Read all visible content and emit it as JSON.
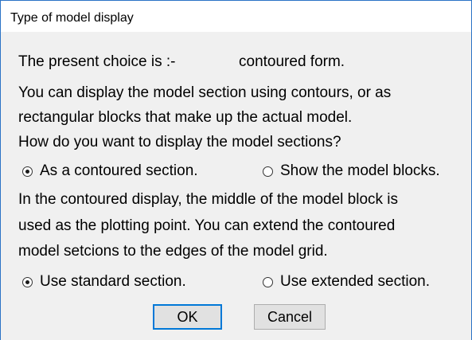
{
  "window": {
    "title": "Type of model display"
  },
  "dialog": {
    "choice_label": "The present choice is :-",
    "choice_value": "contoured form.",
    "desc_line1": "You can display the model section using contours, or as",
    "desc_line2": "rectangular blocks that make up the actual model.",
    "question": "How do you want to display the model sections?",
    "display_options": [
      {
        "label": "As a contoured section.",
        "checked": true
      },
      {
        "label": "Show the model blocks.",
        "checked": false
      }
    ],
    "contour_line1": "In the contoured display, the middle of the model block is",
    "contour_line2": "used as the plotting point. You can extend the contoured",
    "contour_line3": "model setcions to the edges of the model grid.",
    "section_options": [
      {
        "label": "Use standard section.",
        "checked": true
      },
      {
        "label": "Use extended section.",
        "checked": false
      }
    ],
    "ok_label": "OK",
    "cancel_label": "Cancel"
  }
}
